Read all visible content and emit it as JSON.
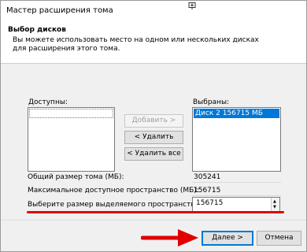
{
  "window": {
    "title": "Мастер расширения тома"
  },
  "header": {
    "title": "Выбор дисков",
    "description": "Вы можете использовать место на одном или нескольких дисках для расширения этого тома."
  },
  "available": {
    "label": "Доступны:",
    "items": []
  },
  "selected": {
    "label": "Выбраны:",
    "items": [
      "Диск 2     156715 МБ"
    ]
  },
  "buttons": {
    "add": "Добавить >",
    "remove": "< Удалить",
    "remove_all": "< Удалить все",
    "next": "Далее >",
    "cancel": "Отмена"
  },
  "fields": {
    "total_label": "Общий размер тома (МБ):",
    "total_value": "305241",
    "max_label": "Максимальное доступное пространство (МБ):",
    "max_value": "156715",
    "select_label": "Выберите размер выделяемого пространства (МБ):",
    "select_value": "156715"
  },
  "colors": {
    "selection": "#0078d7",
    "annotation": "#e00000"
  },
  "icons": {
    "title_icon": "pin-icon",
    "arrow": "red-arrow-icon"
  }
}
